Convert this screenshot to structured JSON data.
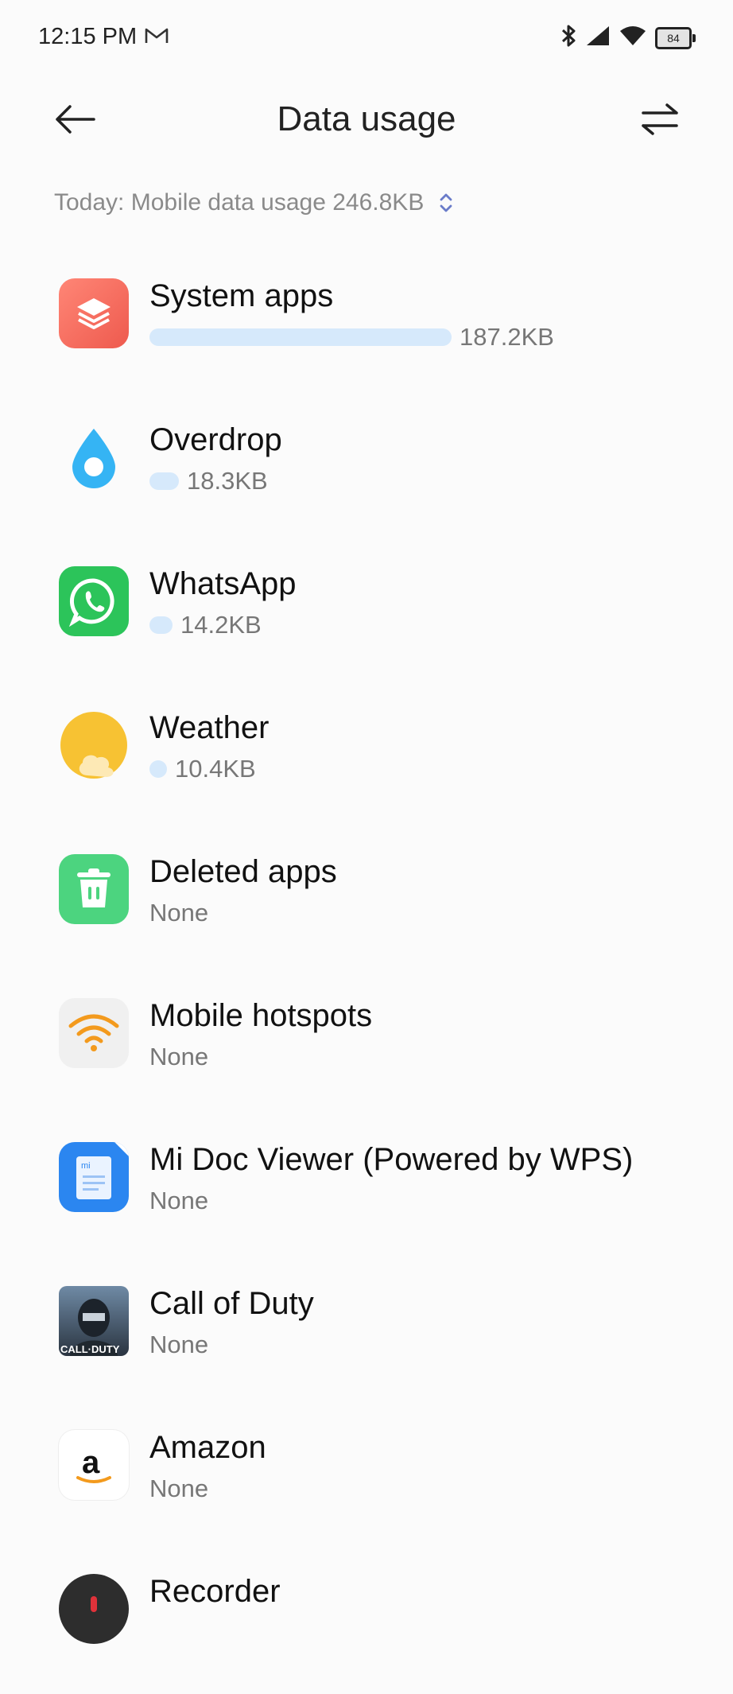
{
  "status": {
    "time": "12:15 PM",
    "battery": "84",
    "icons": [
      "gmail-icon",
      "bluetooth-icon",
      "cellular-signal-icon",
      "wifi-icon",
      "battery-icon"
    ]
  },
  "header": {
    "title": "Data usage",
    "back_icon": "back-arrow-icon",
    "filter_icon": "swap-arrows-icon"
  },
  "summary": {
    "text": "Today: Mobile data usage 246.8KB",
    "icon": "sort-chevrons-icon"
  },
  "apps": [
    {
      "name": "System apps",
      "usage": "187.2KB",
      "fraction": 0.759,
      "icon": "system-apps-icon",
      "color": "#f26e5e"
    },
    {
      "name": "Overdrop",
      "usage": "18.3KB",
      "fraction": 0.074,
      "icon": "overdrop-icon",
      "color": "#2aa3f0"
    },
    {
      "name": "WhatsApp",
      "usage": "14.2KB",
      "fraction": 0.058,
      "icon": "whatsapp-icon",
      "color": "#25d366"
    },
    {
      "name": "Weather",
      "usage": "10.4KB",
      "fraction": 0.042,
      "icon": "weather-icon",
      "color": "#f7c233"
    },
    {
      "name": "Deleted apps",
      "usage": "None",
      "icon": "trash-icon",
      "color": "#4cd47f"
    },
    {
      "name": "Mobile hotspots",
      "usage": "None",
      "icon": "hotspot-icon",
      "color": "#f39a1d"
    },
    {
      "name": "Mi Doc Viewer (Powered by WPS)",
      "usage": "None",
      "icon": "document-icon",
      "color": "#2b86f0"
    },
    {
      "name": "Call of Duty",
      "usage": "None",
      "icon": "call-of-duty-icon",
      "color": "#3b4a5a"
    },
    {
      "name": "Amazon",
      "usage": "None",
      "icon": "amazon-icon",
      "color": "#222222"
    },
    {
      "name": "Recorder",
      "usage": "",
      "icon": "recorder-icon",
      "color": "#333333"
    }
  ],
  "icon_text": {
    "doc_badge": "mi",
    "cod_label": "CALL·DUTY",
    "amazon_letter": "a"
  }
}
